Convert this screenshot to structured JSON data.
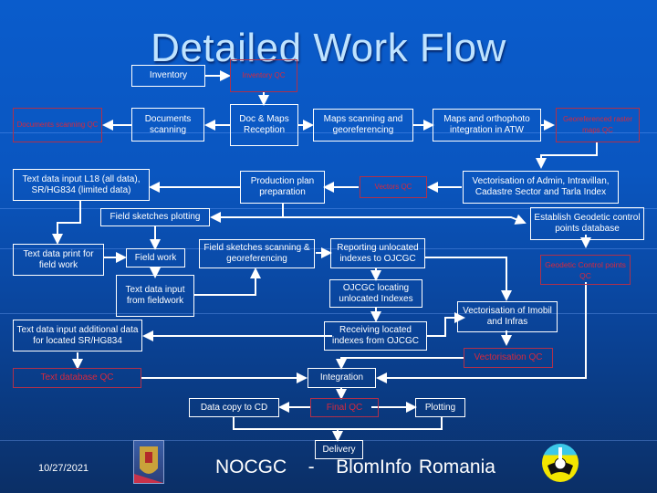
{
  "title": "Detailed Work Flow",
  "colors": {
    "background": "#0a56c0",
    "box_border": "#ffffff",
    "qc_text": "#d8283c",
    "qc_border": "#b0304a"
  },
  "nodes": {
    "inventory": "Inventory",
    "inventory_qc": "Inventory QC",
    "documents_scanning_qc": "Documents scanning QC",
    "documents_scanning": "Documents scanning",
    "doc_maps_reception": "Doc & Maps Reception",
    "maps_scanning": "Maps scanning and georeferencing",
    "maps_ortho": "Maps and orthophoto integration in ATW",
    "raster_qc": "Georeferenced raster maps QC",
    "text_data_input_l18": "Text data input L18 (all data), SR/HG834 (limited data)",
    "production_plan": "Production plan preparation",
    "vectors_qc": "Vectors QC",
    "vectorisation_admin": "Vectorisation of Admin, Intravillan, Cadastre Sector and Tarla Index",
    "field_sketches_plotting": "Field sketches plotting",
    "establish_geodetic": "Establish Geodetic control points database",
    "text_data_print": "Text data print for field work",
    "field_work": "Field work",
    "field_sketches_scanning": "Field sketches scanning & georeferencing",
    "reporting_unlocated": "Reporting unlocated indexes to OJCGC",
    "geodetic_qc": "Geodetic Control points QC",
    "text_data_fieldwork": "Text data input from fieldwork",
    "ojcgc_locating": "OJCGC locating unlocated Indexes",
    "vectorisation_imobil": "Vectorisation of Imobil and Infras",
    "text_data_additional": "Text data input additional data for located SR/HG834",
    "receiving_located": "Receiving located indexes from OJCGC",
    "vectorisation_qc": "Vectorisation QC",
    "text_database_qc": "Text database QC",
    "integration": "Integration",
    "data_copy_cd": "Data copy to CD",
    "final_qc": "Final QC",
    "plotting": "Plotting",
    "delivery": "Delivery"
  },
  "footer": {
    "date": "10/27/2021",
    "text": "NOCGC   -   BlomInfo Romania",
    "left_logo": "romania-coat-of-arms-icon",
    "right_logo": "blominfo-logo-icon"
  }
}
